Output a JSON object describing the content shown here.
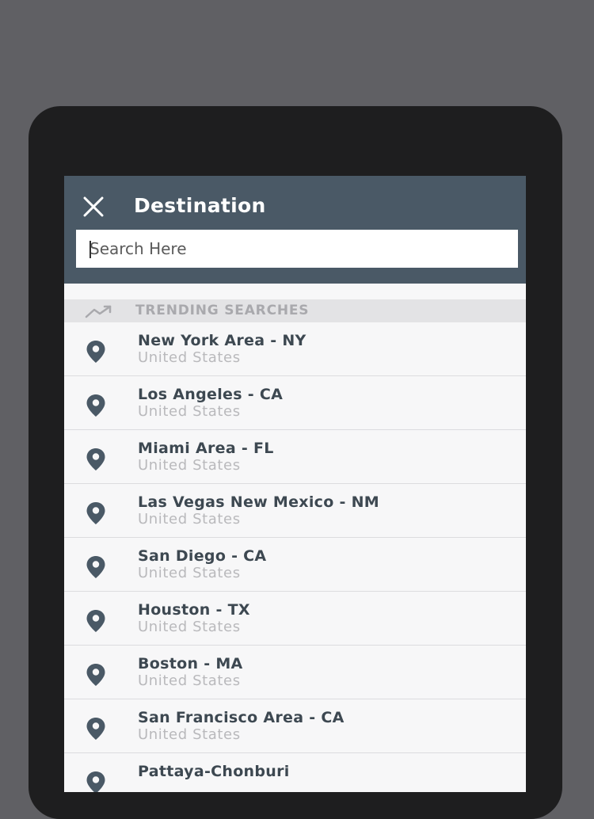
{
  "header": {
    "title": "Destination",
    "close_icon": "close-icon"
  },
  "search": {
    "placeholder": "Search Here",
    "value": ""
  },
  "section": {
    "title": "TRENDING SEARCHES",
    "icon": "trending-up-icon"
  },
  "colors": {
    "header_bg": "#4a5966",
    "item_title": "#3d4851",
    "item_sub": "#b9b9bc",
    "section_bg": "#e3e3e5"
  },
  "destinations": [
    {
      "title": "New York Area - NY",
      "subtitle": "United States"
    },
    {
      "title": "Los Angeles - CA",
      "subtitle": "United States"
    },
    {
      "title": "Miami Area - FL",
      "subtitle": "United States"
    },
    {
      "title": "Las Vegas New Mexico - NM",
      "subtitle": "United States"
    },
    {
      "title": "San Diego - CA",
      "subtitle": "United States"
    },
    {
      "title": "Houston - TX",
      "subtitle": "United States"
    },
    {
      "title": "Boston - MA",
      "subtitle": "United States"
    },
    {
      "title": "San Francisco Area - CA",
      "subtitle": "United States"
    },
    {
      "title": "Pattaya-Chonburi",
      "subtitle": ""
    }
  ]
}
